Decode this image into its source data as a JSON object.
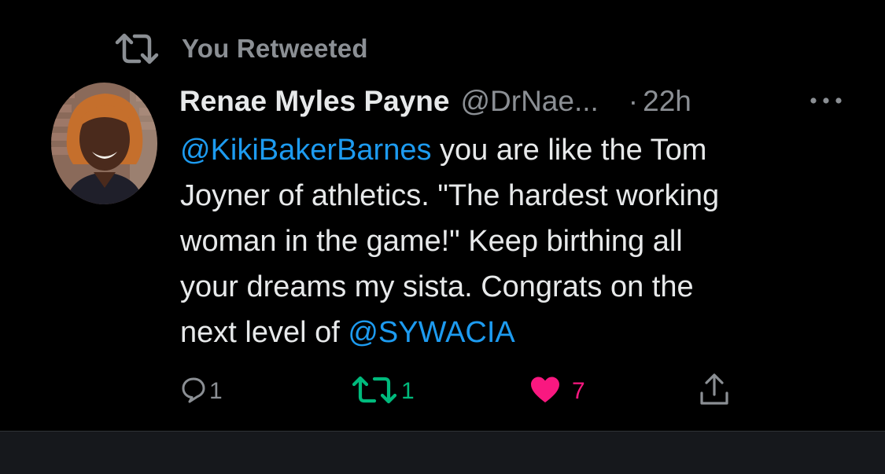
{
  "retweet_banner": {
    "label": "You Retweeted",
    "icon": "retweet-icon"
  },
  "tweet": {
    "author_name": "Renae Myles Payne",
    "author_handle": "@DrNae...",
    "dot": "·",
    "time": "22h",
    "body_lines": [
      {
        "mention": "@KikiBakerBarnes",
        "text": " you are like the Tom"
      },
      {
        "text": "Joyner of athletics. \"The hardest working"
      },
      {
        "text": "woman in the game!\" Keep birthing all"
      },
      {
        "text": "your dreams my sista. Congrats on the"
      },
      {
        "text": "next level of ",
        "mention_end": "@SYWACIA"
      }
    ]
  },
  "actions": {
    "reply": {
      "icon": "reply-bubble-icon",
      "count": "1"
    },
    "retweet": {
      "icon": "retweet-icon",
      "count": "1"
    },
    "like": {
      "icon": "heart-icon",
      "count": "7"
    },
    "share": {
      "icon": "share-icon"
    }
  },
  "colors": {
    "background": "#000000",
    "text": "#e7e9ea",
    "muted": "#8b8f94",
    "mention": "#1d9bf0",
    "retweet_green": "#00ba7c",
    "like_pink": "#f91880"
  }
}
